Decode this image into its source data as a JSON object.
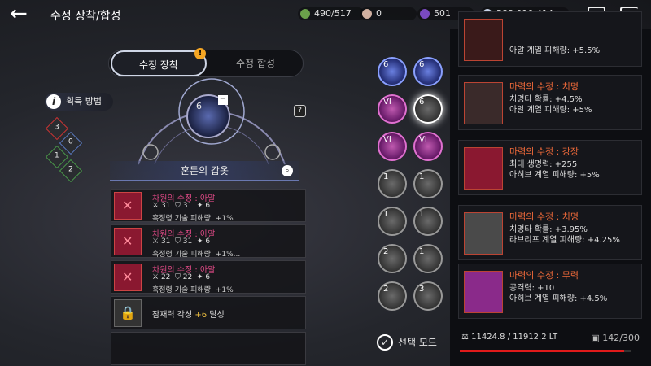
{
  "header": {
    "title": "수정 장착/합성",
    "currencies": [
      {
        "value": "490/517",
        "color": "#6ba14a"
      },
      {
        "value": "0",
        "color": "#d0b0a0"
      },
      {
        "value": "501",
        "color": "#7a4ac0"
      },
      {
        "value": "588,010,414",
        "color": "#c8d4e8"
      }
    ]
  },
  "tabs": {
    "equip": "수정 장착",
    "synth": "수정 합성",
    "equip_badge": "!"
  },
  "acquire_label": "획득 방법",
  "runes": [
    "3",
    "0",
    "1",
    "2"
  ],
  "slot": {
    "level": "6",
    "remove": "−"
  },
  "gear_name": "혼돈의 갑옷",
  "list": [
    {
      "name": "차원의 수정 : 아알",
      "atk": "31",
      "def": "31",
      "misc": "6",
      "effect": "흑정령 기술 피해량: +1%"
    },
    {
      "name": "차원의 수정 : 아알",
      "atk": "31",
      "def": "31",
      "misc": "6",
      "effect": "흑정령 기술 피해량: +1%..."
    },
    {
      "name": "차원의 수정 : 아알",
      "atk": "22",
      "def": "22",
      "misc": "6",
      "effect": "흑정령 기술 피해량: +1%"
    }
  ],
  "locked": {
    "text": "잠재력 각성",
    "value": "+6",
    "suffix": "달성"
  },
  "gems": [
    {
      "lv": "6",
      "kind": "blue"
    },
    {
      "lv": "6",
      "kind": "blue"
    },
    {
      "lv": "VI",
      "kind": "pink"
    },
    {
      "lv": "6",
      "kind": "grey",
      "selected": true
    },
    {
      "lv": "VI",
      "kind": "pink"
    },
    {
      "lv": "VI",
      "kind": "pink"
    },
    {
      "lv": "1",
      "kind": "grey"
    },
    {
      "lv": "1",
      "kind": "grey"
    },
    {
      "lv": "1",
      "kind": "grey"
    },
    {
      "lv": "1",
      "kind": "grey"
    },
    {
      "lv": "2",
      "kind": "grey"
    },
    {
      "lv": "1",
      "kind": "grey"
    },
    {
      "lv": "2",
      "kind": "grey"
    },
    {
      "lv": "3",
      "kind": "grey"
    }
  ],
  "select_mode": "선택 모드",
  "cards": [
    {
      "name": "",
      "l1": "아알 계열 피해량: +5.5%",
      "l2": "",
      "color": "#3a1a1a"
    },
    {
      "name": "마력의 수정 : 치명",
      "l1": "치명타 확률: +4.5%",
      "l2": "아알 계열 피해량: +5%",
      "color": "#3a2a2a"
    },
    {
      "name": "마력의 수정 : 강장",
      "l1": "최대 생명력: +255",
      "l2": "아히브 계열 피해량: +5%",
      "color": "#8a1830"
    },
    {
      "name": "마력의 수정 : 치명",
      "l1": "치명타 확률: +3.95%",
      "l2": "라브리프 계열 피해량: +4.25%",
      "color": "#4a4a4a"
    },
    {
      "name": "마력의 수정 : 무력",
      "l1": "공격력: +10",
      "l2": "아히브 계열 피해량: +4.5%",
      "color": "#8a2a8a"
    }
  ],
  "footer": {
    "lt": "11424.8 / 11912.2 LT",
    "capacity": "142/300",
    "progress": 0.96
  }
}
